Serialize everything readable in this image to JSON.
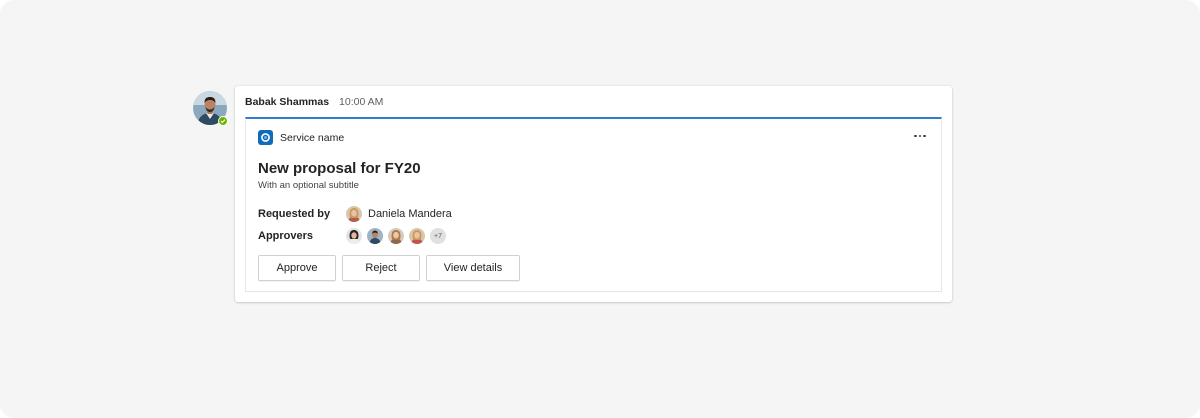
{
  "message": {
    "author": "Babak Shammas",
    "time": "10:00 AM",
    "presence_color": "#6bb700"
  },
  "card": {
    "accent_color": "#2f7fd1",
    "service_name": "Service name",
    "service_icon": "service-ring-icon",
    "more_options_icon": "more-options-icon",
    "title": "New proposal for FY20",
    "subtitle": "With an optional subtitle",
    "facts": {
      "requested_by_label": "Requested by",
      "requester_name": "Daniela Mandera",
      "approvers_label": "Approvers",
      "approvers_extra_count": "+7"
    },
    "actions": {
      "approve": "Approve",
      "reject": "Reject",
      "view_details": "View details"
    }
  }
}
